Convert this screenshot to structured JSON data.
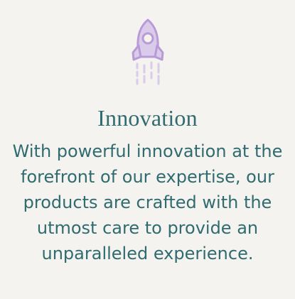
{
  "feature": {
    "icon": "rocket-icon",
    "accent_color": "#b89bd6",
    "text_color": "#2f6b6f",
    "background_color": "#f5f3ef",
    "title": "Innovation",
    "description": "With powerful innovation at the forefront of our expertise, our products are crafted with the utmost care to provide an unparalleled experience."
  }
}
